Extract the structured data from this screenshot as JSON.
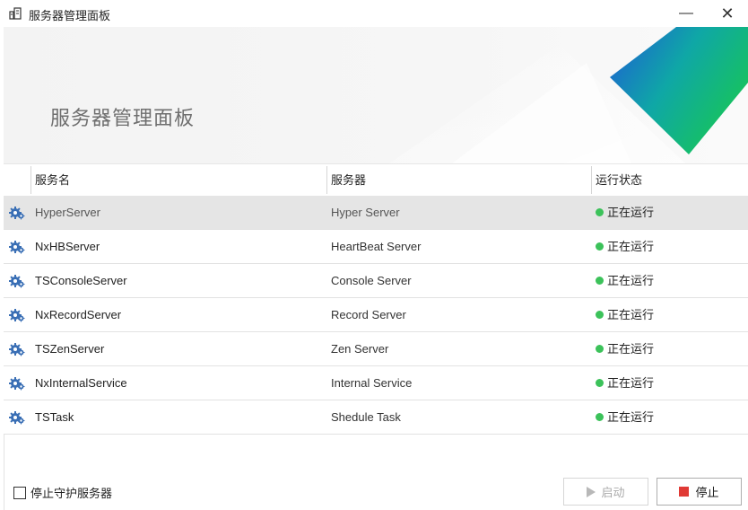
{
  "window": {
    "title": "服务器管理面板",
    "minimize_glyph": "—",
    "close_glyph": "✕",
    "app_icon": "server-app-icon"
  },
  "banner": {
    "title": "服务器管理面板",
    "accent_colors": [
      "#1e5bd6",
      "#17c45a"
    ]
  },
  "table": {
    "columns": [
      "服务名",
      "服务器",
      "运行状态"
    ],
    "status_color": "#3cc25a",
    "row_icon": "gear-icon",
    "rows": [
      {
        "name": "HyperServer",
        "server": "Hyper Server",
        "status": "正在运行",
        "selected": true
      },
      {
        "name": "NxHBServer",
        "server": "HeartBeat Server",
        "status": "正在运行"
      },
      {
        "name": "TSConsoleServer",
        "server": "Console Server",
        "status": "正在运行"
      },
      {
        "name": "NxRecordServer",
        "server": "Record Server",
        "status": "正在运行"
      },
      {
        "name": "TSZenServer",
        "server": "Zen Server",
        "status": "正在运行"
      },
      {
        "name": "NxInternalService",
        "server": "Internal Service",
        "status": "正在运行"
      },
      {
        "name": "TSTask",
        "server": "Shedule Task",
        "status": "正在运行"
      }
    ]
  },
  "footer": {
    "checkbox_label": "停止守护服务器",
    "checkbox_checked": false,
    "start_label": "启动",
    "stop_label": "停止",
    "start_enabled": false
  }
}
